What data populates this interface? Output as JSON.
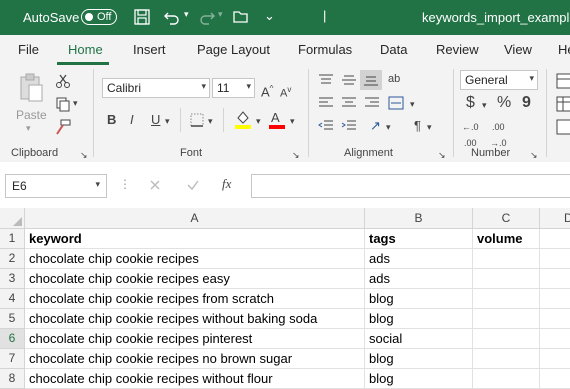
{
  "titlebar": {
    "autosave_label": "AutoSave",
    "autosave_state": "Off",
    "filename": "keywords_import_example",
    "icons": [
      "save-icon",
      "undo-icon",
      "redo-icon",
      "open-folder-icon",
      "customize-quick-access-icon"
    ]
  },
  "menu": {
    "tabs": [
      "File",
      "Home",
      "Insert",
      "Page Layout",
      "Formulas",
      "Data",
      "Review",
      "View",
      "He"
    ],
    "active": "Home"
  },
  "ribbon": {
    "clipboard": {
      "label": "Clipboard",
      "paste": "Paste"
    },
    "font": {
      "label": "Font",
      "name": "Calibri",
      "size": "11",
      "bold": "B",
      "italic": "I",
      "underline": "U",
      "grow": "A",
      "shrink": "A"
    },
    "alignment": {
      "label": "Alignment",
      "wrap": "ab"
    },
    "number": {
      "label": "Number",
      "format": "General",
      "currency": "$",
      "percent": "%",
      "comma": "9"
    },
    "accent": "#217346",
    "fill_color": "#ffff00",
    "font_color": "#ff0000"
  },
  "formula_bar": {
    "name_box": "E6",
    "fx": "fx",
    "value": ""
  },
  "sheet": {
    "columns": [
      "A",
      "B",
      "C",
      "D"
    ],
    "rows": [
      {
        "num": "1",
        "cells": [
          "keyword",
          "tags",
          "volume"
        ]
      },
      {
        "num": "2",
        "cells": [
          "chocolate chip cookie recipes",
          "ads",
          ""
        ]
      },
      {
        "num": "3",
        "cells": [
          "chocolate chip cookie recipes easy",
          "ads",
          ""
        ]
      },
      {
        "num": "4",
        "cells": [
          "chocolate chip cookie recipes from scratch",
          "blog",
          ""
        ]
      },
      {
        "num": "5",
        "cells": [
          "chocolate chip cookie recipes without baking soda",
          "blog",
          ""
        ]
      },
      {
        "num": "6",
        "cells": [
          "chocolate chip cookie recipes pinterest",
          "social",
          ""
        ]
      },
      {
        "num": "7",
        "cells": [
          "chocolate chip cookie recipes no brown sugar",
          "blog",
          ""
        ]
      },
      {
        "num": "8",
        "cells": [
          "chocolate chip cookie recipes without flour",
          "blog",
          ""
        ]
      }
    ],
    "active_cell": "E6"
  }
}
